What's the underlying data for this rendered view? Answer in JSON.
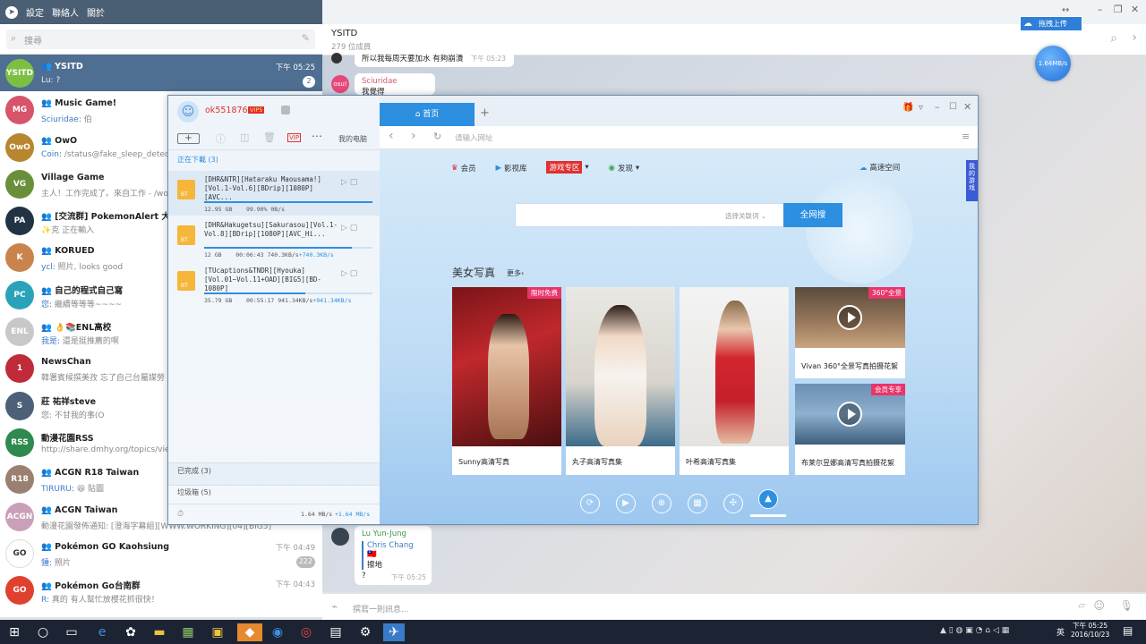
{
  "tg": {
    "menu": [
      "設定",
      "聯絡人",
      "關於"
    ],
    "search_placeholder": "搜尋",
    "chats": [
      {
        "name": "YSITD",
        "group": true,
        "who": "",
        "msg": "Lu: ?",
        "time": "下午 05:25",
        "badge": "2",
        "color": "#7cc043",
        "initial": "YSITD",
        "active": true
      },
      {
        "name": "Music Game!",
        "group": true,
        "who": "Sciuridae:",
        "msg": " 伯",
        "time": "",
        "badge": "",
        "color": "#d8546a",
        "initial": "MG"
      },
      {
        "name": "OwO",
        "group": true,
        "who": "Coin:",
        "msg": " /status@fake_sleep_detect_bo",
        "time": "",
        "badge": "",
        "color": "#b8862f",
        "initial": "OwO"
      },
      {
        "name": "Village Game",
        "group": false,
        "who": "",
        "msg": "主人！工作完成了。來自工作 - /work",
        "time": "",
        "badge": "",
        "color": "#6a8f3a",
        "initial": "VG"
      },
      {
        "name": "[交流群] PokemonAlert 大台北",
        "group": true,
        "who": "",
        "msg": "✨克 正在輸入",
        "time": "",
        "badge": "",
        "color": "#223344",
        "initial": "PA"
      },
      {
        "name": "KORUED",
        "group": true,
        "who": "ycl:",
        "msg": " 照片, looks good",
        "time": "",
        "badge": "",
        "color": "#c9844e",
        "initial": "K"
      },
      {
        "name": "自己的程式自己寫",
        "group": true,
        "who": "您:",
        "msg": " 繼續等等等~~~~",
        "time": "",
        "badge": "",
        "color": "#2aa3b9",
        "initial": "PC"
      },
      {
        "name": "👌📚ENL高校",
        "group": true,
        "who": "我是:",
        "msg": " 還是挺推薦的啊",
        "time": "",
        "badge": "",
        "color": "#c8c8c8",
        "initial": "ENL"
      },
      {
        "name": "NewsChan",
        "group": false,
        "who": "",
        "msg": "韓署賓候撰美孜 忘了自己台屬媒勞",
        "time": "",
        "badge": "",
        "color": "#c02b3a",
        "initial": "1"
      },
      {
        "name": "莊 祐祥steve",
        "group": false,
        "who": "",
        "msg": "您: 不甘我的事(O",
        "time": "",
        "badge": "",
        "color": "#4c6077",
        "initial": "S"
      },
      {
        "name": "動漫花園RSS",
        "group": false,
        "who": "",
        "msg": "http://share.dmhy.org/topics/view/",
        "time": "",
        "badge": "",
        "color": "#2f8a4f",
        "initial": "RSS"
      },
      {
        "name": "ACGN R18 Taiwan",
        "group": true,
        "who": "TIRURU:",
        "msg": " 😆 貼圖",
        "time": "",
        "badge": "",
        "color": "#9a8070",
        "initial": "R18"
      },
      {
        "name": "ACGN Taiwan",
        "group": true,
        "who": "",
        "msg": "動漫花園發佈通知: [澄海字幕組][WWW.WORKING][04][BIG5]",
        "time": "",
        "badge": "",
        "color": "#c9a0b8",
        "initial": "ACGN"
      },
      {
        "name": "Pokémon GO Kaohsiung",
        "group": true,
        "who": "鍾:",
        "msg": " 照片",
        "time": "下午 04:49",
        "badge": "222",
        "color": "#ffffff",
        "initial": "GO"
      },
      {
        "name": "Pokémon Go台南群",
        "group": true,
        "who": "R:",
        "msg": " 真的 有人幫忙放櫻花抓很快！",
        "time": "下午 04:43",
        "badge": "",
        "color": "#e0412f",
        "initial": "GO"
      }
    ],
    "header_title": "YSITD",
    "header_sub": "279 位成員",
    "composer_placeholder": "撰寫一則訊息...",
    "msgs": {
      "top_text": "所以我每周天要加水 有夠崩潰",
      "top_time": "下午 05:23",
      "sci_name": "Sciuridae",
      "sci_text": "我覺得",
      "lu_name": "Lu Yun-Jung",
      "reply_name": "Chris Chang 🇹🇼",
      "reply_text": "擦地",
      "lu_text": "?",
      "lu_time": "下午 05:25"
    },
    "upload_btn": "拖拽上传",
    "speed_ball": "1.64MB/s"
  },
  "xl": {
    "user": "ok551876",
    "vip": "VIP5",
    "my_pc": "我的电脑",
    "downloading_label": "正在下載 (3)",
    "tasks": [
      {
        "name": "[DHR&NTR][Hataraku Maousama!][Vol.1-Vol.6][BDrip][1080P][AVC...",
        "size": "12.95 GB",
        "progress": "99.90%",
        "speed": "0B/s",
        "pct": 99.9
      },
      {
        "name": "[DHR&Hakugetsu][Sakurasou][Vol.1-Vol.8][BDrip][1080P][AVC_Hi...",
        "size": "12 GB",
        "progress": "00:06:43",
        "speed": "740.3KB/s",
        "speed2": "+740.3KB/s",
        "pct": 88
      },
      {
        "name": "[TUcaptions&TNDR][Hyouka][Vol.01~Vol.11+OAD][BIG5][BD-1080P]",
        "size": "35.79 GB",
        "progress": "00:55:17",
        "speed": "941.34KB/s",
        "speed2": "+941.34KB/s",
        "pct": 60
      }
    ],
    "completed": "已完成 (3)",
    "trash": "垃圾箱 (5)",
    "total_speed": "1.64 MB/s",
    "total_speed2": "+1.64 MB/s",
    "tab_home": "首页",
    "url_placeholder": "请输入网址",
    "nav": [
      "会员",
      "影视库",
      "游戏专区",
      "发现"
    ],
    "nav_right": "高速空间",
    "search_select": "选择关联词",
    "search_btn": "全网搜",
    "side_tab": "我的游戏",
    "section_title": "美女写真",
    "section_more": "更多›",
    "photos": [
      {
        "cap": "Sunny高清写真",
        "tag": "限时免费"
      },
      {
        "cap": "丸子高清写真集",
        "tag": ""
      },
      {
        "cap": "叶希高清写真集",
        "tag": ""
      },
      {
        "cap": "Vivan 360°全景写真拍摄花絮",
        "tag": "360°全景"
      },
      {
        "cap": "布莱尔昱娜高清写真拍摄花絮",
        "tag": "会员专享"
      }
    ]
  },
  "taskbar": {
    "time": "下午 05:25",
    "date": "2016/10/23",
    "lang": "英"
  }
}
